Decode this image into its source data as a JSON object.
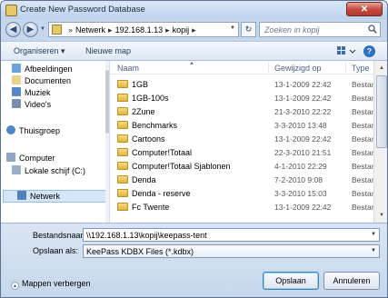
{
  "window": {
    "title": "Create New Password Database",
    "close_label": "✕"
  },
  "nav": {
    "crumbs": [
      "Netwerk",
      "192.168.1.13",
      "kopij"
    ],
    "search_placeholder": "Zoeken in kopij"
  },
  "toolbar": {
    "organize_label": "Organiseren ▾",
    "new_folder_label": "Nieuwe map"
  },
  "sidebar": {
    "items": [
      {
        "label": "Afbeeldingen"
      },
      {
        "label": "Documenten"
      },
      {
        "label": "Muziek"
      },
      {
        "label": "Video's"
      },
      {
        "label": "Thuisgroep"
      },
      {
        "label": "Computer"
      },
      {
        "label": "Lokale schijf (C:)"
      },
      {
        "label": "Netwerk"
      }
    ]
  },
  "files": {
    "columns": {
      "name": "Naam",
      "date": "Gewijzigd op",
      "type": "Type"
    },
    "rows": [
      {
        "name": "1GB",
        "date": "13-1-2009 22:42",
        "type": "Bestan"
      },
      {
        "name": "1GB-100s",
        "date": "13-1-2009 22:42",
        "type": "Bestan"
      },
      {
        "name": "2Zune",
        "date": "21-3-2010 22:22",
        "type": "Bestan"
      },
      {
        "name": "Benchmarks",
        "date": "3-3-2010 13:48",
        "type": "Bestan"
      },
      {
        "name": "Cartoons",
        "date": "13-1-2009 22:42",
        "type": "Bestan"
      },
      {
        "name": "Computer!Totaal",
        "date": "22-3-2010 21:51",
        "type": "Bestan"
      },
      {
        "name": "Computer!Totaal Sjablonen",
        "date": "4-1-2010 22:29",
        "type": "Bestan"
      },
      {
        "name": "Denda",
        "date": "7-2-2010 9:08",
        "type": "Bestan"
      },
      {
        "name": "Denda - reserve",
        "date": "3-3-2010 15:03",
        "type": "Bestan"
      },
      {
        "name": "Fc Twente",
        "date": "13-1-2009 22:42",
        "type": "Bestan"
      }
    ]
  },
  "save": {
    "filename_label": "Bestandsnaam:",
    "filename_value": "\\\\192.168.1.13\\kopij\\keepass-tent",
    "filetype_label": "Opslaan als:",
    "filetype_value": "KeePass KDBX Files (*.kdbx)",
    "hide_folders_label": "Mappen verbergen",
    "save_button": "Opslaan",
    "cancel_button": "Annuleren"
  }
}
